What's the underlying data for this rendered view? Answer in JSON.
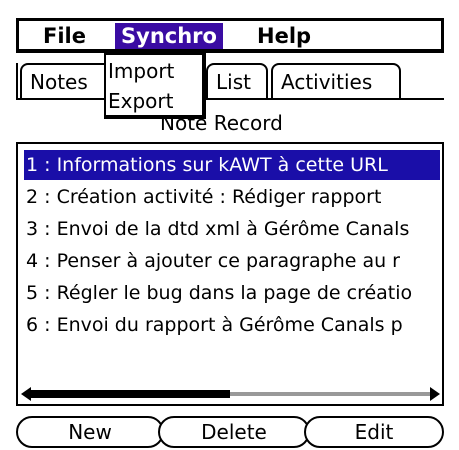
{
  "menubar": {
    "file": "File",
    "synchro": "Synchro",
    "help": "Help"
  },
  "tabs": {
    "notes": "Notes",
    "list": "List",
    "activities": "Activities"
  },
  "dropdown": {
    "import": "Import",
    "export": "Export"
  },
  "record_title": "Note Record",
  "notes": [
    "1 : Informations sur kAWT à cette URL",
    "2 : Création activité : Rédiger rapport",
    "3 : Envoi de la dtd xml à Gérôme Canals",
    "4 : Penser à ajouter ce paragraphe au r",
    "5 : Régler le bug dans la page de créatio",
    "6 : Envoi du rapport à Gérôme Canals p"
  ],
  "buttons": {
    "new": "New",
    "delete": "Delete",
    "edit": "Edit"
  },
  "colors": {
    "menu_highlight": "#3a0ca3",
    "selection": "#1a0ea8"
  }
}
